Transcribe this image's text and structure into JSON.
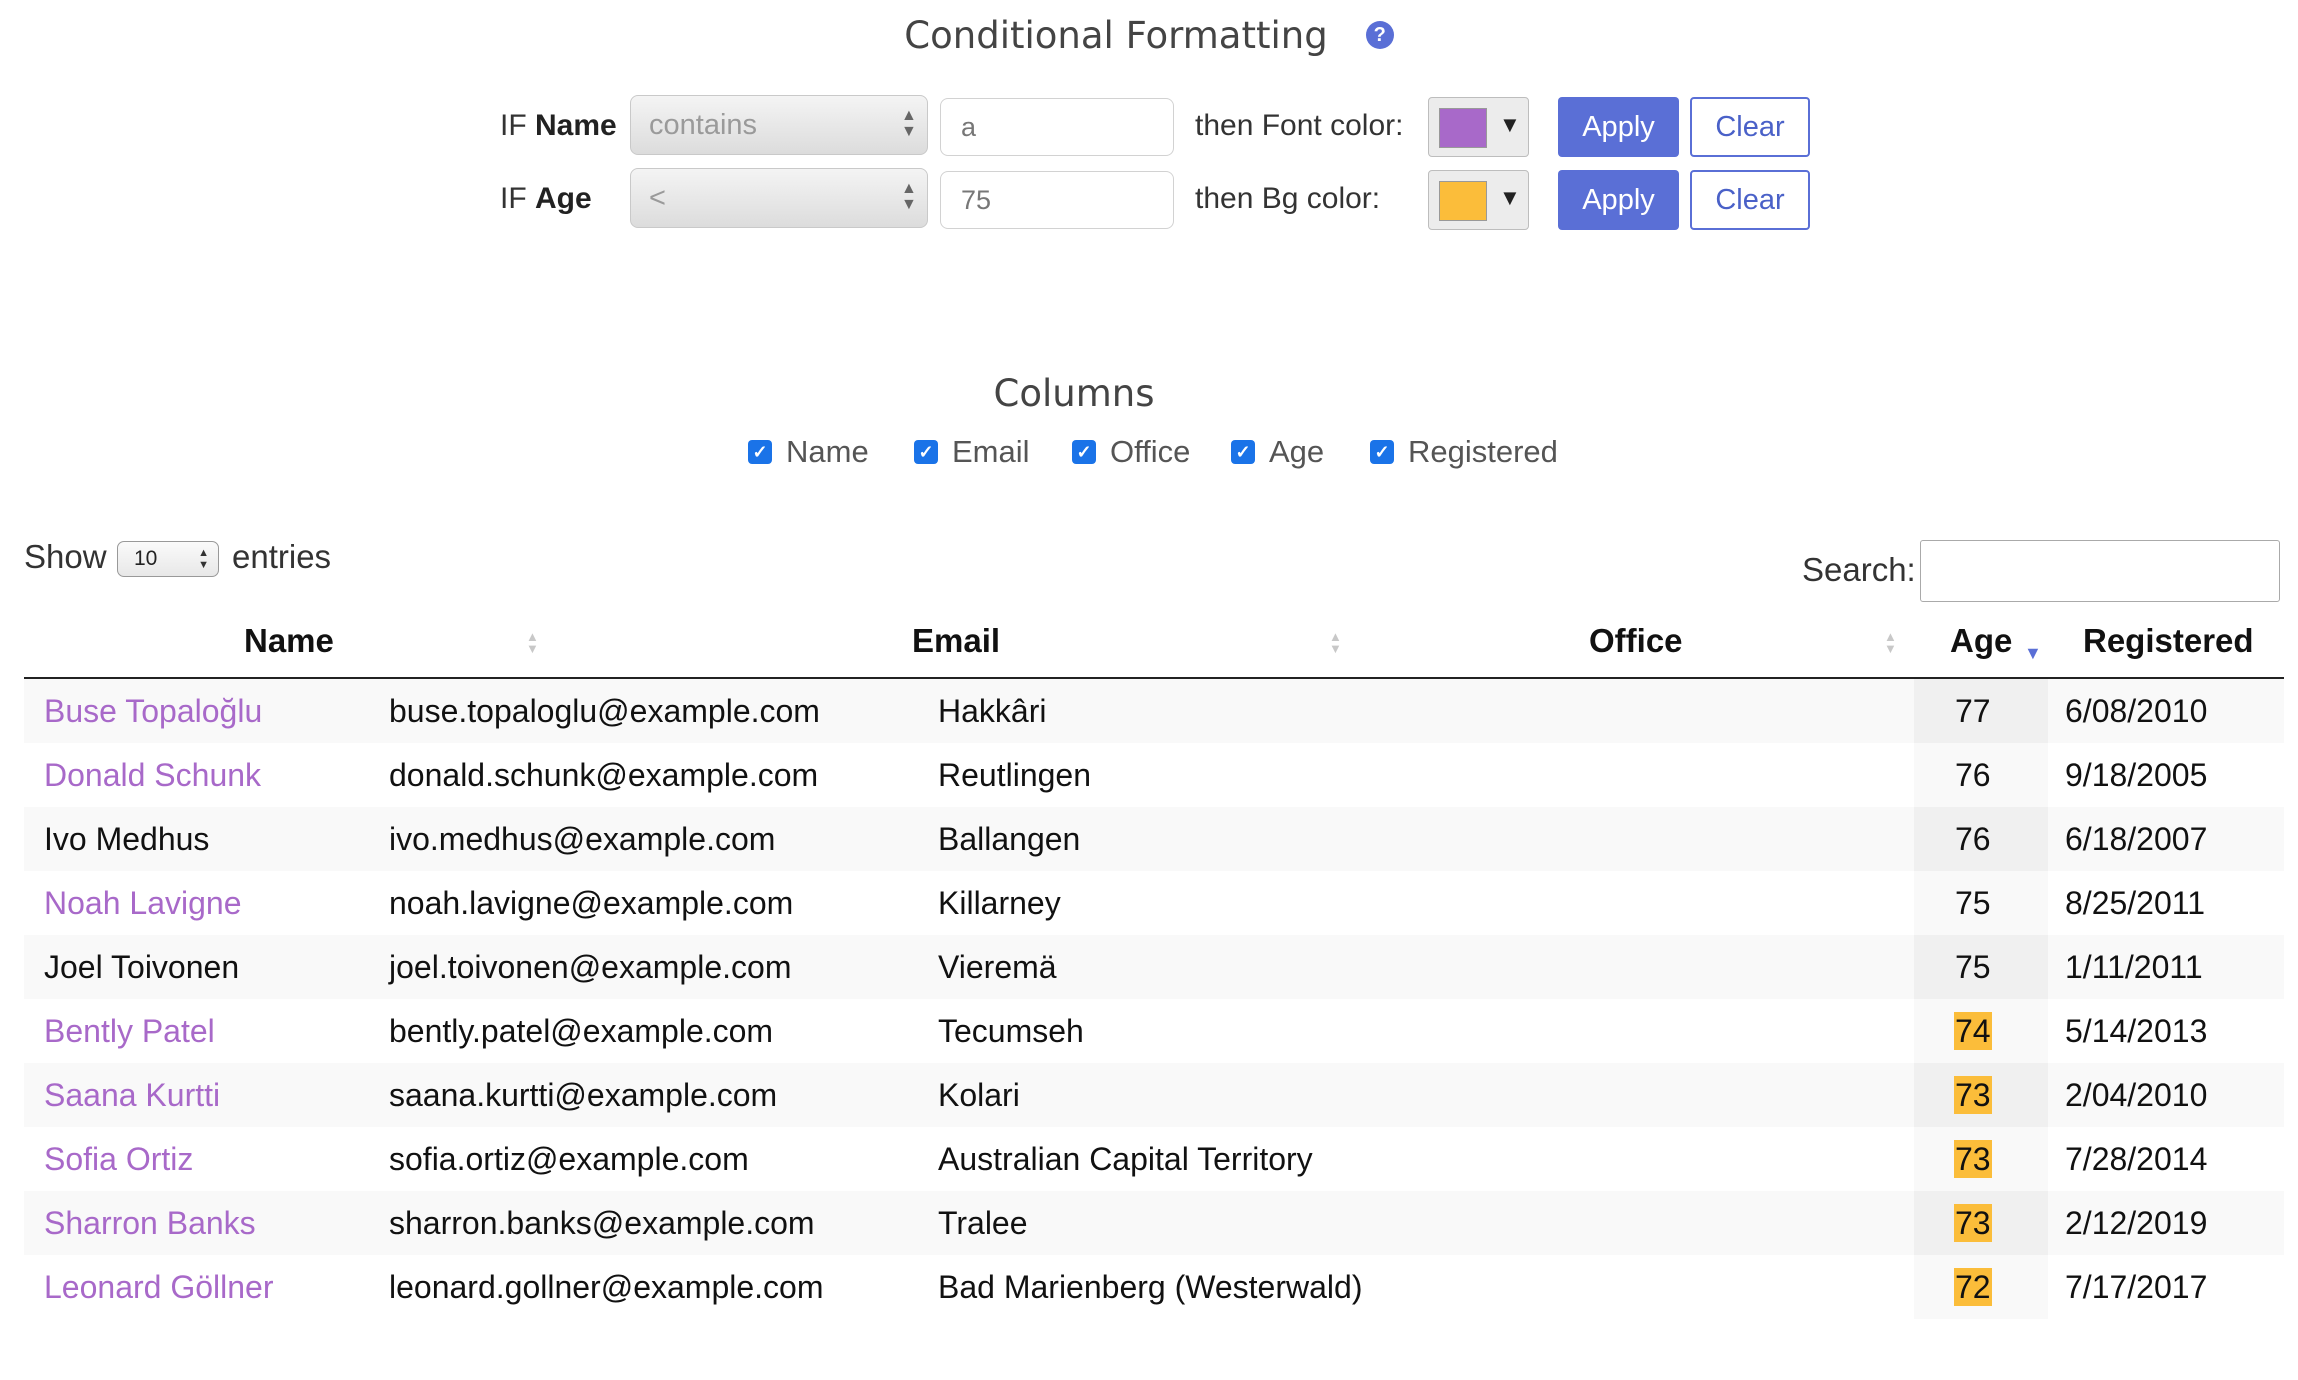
{
  "header": {
    "title": "Conditional Formatting",
    "help_glyph": "?"
  },
  "rules": [
    {
      "if_prefix": "IF",
      "field": "Name",
      "operator": "contains",
      "value": "a",
      "then_label": "then Font color:",
      "color": "#a869c9",
      "apply_label": "Apply",
      "clear_label": "Clear"
    },
    {
      "if_prefix": "IF",
      "field": "Age",
      "operator": "<",
      "value": "75",
      "then_label": "then Bg color:",
      "color": "#fbbd3a",
      "apply_label": "Apply",
      "clear_label": "Clear"
    }
  ],
  "columns_panel": {
    "title": "Columns",
    "items": [
      {
        "label": "Name",
        "checked": true
      },
      {
        "label": "Email",
        "checked": true
      },
      {
        "label": "Office",
        "checked": true
      },
      {
        "label": "Age",
        "checked": true
      },
      {
        "label": "Registered",
        "checked": true
      }
    ]
  },
  "controls": {
    "show_label": "Show",
    "length_value": "10",
    "entries_label": "entries",
    "search_label": "Search:",
    "search_value": ""
  },
  "table": {
    "headers": {
      "name": "Name",
      "email": "Email",
      "office": "Office",
      "age": "Age",
      "registered": "Registered"
    },
    "sort": {
      "column": "age",
      "direction": "desc"
    },
    "rows": [
      {
        "name": "Buse Topaloğlu",
        "email": "buse.topaloglu@example.com",
        "office": "Hakkâri",
        "age": "77",
        "registered": "6/08/2010",
        "name_hl": true,
        "age_hl": false
      },
      {
        "name": "Donald Schunk",
        "email": "donald.schunk@example.com",
        "office": "Reutlingen",
        "age": "76",
        "registered": "9/18/2005",
        "name_hl": true,
        "age_hl": false
      },
      {
        "name": "Ivo Medhus",
        "email": "ivo.medhus@example.com",
        "office": "Ballangen",
        "age": "76",
        "registered": "6/18/2007",
        "name_hl": false,
        "age_hl": false
      },
      {
        "name": "Noah Lavigne",
        "email": "noah.lavigne@example.com",
        "office": "Killarney",
        "age": "75",
        "registered": "8/25/2011",
        "name_hl": true,
        "age_hl": false
      },
      {
        "name": "Joel Toivonen",
        "email": "joel.toivonen@example.com",
        "office": "Vieremä",
        "age": "75",
        "registered": "1/11/2011",
        "name_hl": false,
        "age_hl": false
      },
      {
        "name": "Bently Patel",
        "email": "bently.patel@example.com",
        "office": "Tecumseh",
        "age": "74",
        "registered": "5/14/2013",
        "name_hl": true,
        "age_hl": true
      },
      {
        "name": "Saana Kurtti",
        "email": "saana.kurtti@example.com",
        "office": "Kolari",
        "age": "73",
        "registered": "2/04/2010",
        "name_hl": true,
        "age_hl": true
      },
      {
        "name": "Sofia Ortiz",
        "email": "sofia.ortiz@example.com",
        "office": "Australian Capital Territory",
        "age": "73",
        "registered": "7/28/2014",
        "name_hl": true,
        "age_hl": true
      },
      {
        "name": "Sharron Banks",
        "email": "sharron.banks@example.com",
        "office": "Tralee",
        "age": "73",
        "registered": "2/12/2019",
        "name_hl": true,
        "age_hl": true
      },
      {
        "name": "Leonard Göllner",
        "email": "leonard.gollner@example.com",
        "office": "Bad Marienberg (Westerwald)",
        "age": "72",
        "registered": "7/17/2017",
        "name_hl": true,
        "age_hl": true
      }
    ]
  }
}
